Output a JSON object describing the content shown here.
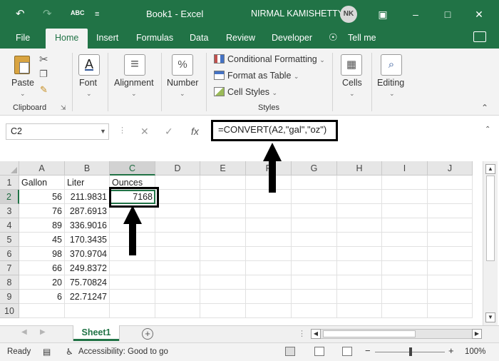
{
  "titlebar": {
    "undo_icon": "undo-icon",
    "redo_icon": "redo-icon",
    "spell_icon_label": "ABC",
    "doc_title": "Book1  -  Excel",
    "user_name": "NIRMAL KAMISHETTY",
    "user_initials": "NK",
    "window_buttons": [
      "ribbon-display-icon",
      "minimize-icon",
      "maximize-icon",
      "close-icon"
    ]
  },
  "tabs": [
    "File",
    "Home",
    "Insert",
    "Formulas",
    "Data",
    "Review",
    "Developer"
  ],
  "active_tab": "Home",
  "tell_me": "Tell me",
  "ribbon": {
    "clipboard": {
      "paste": "Paste",
      "group": "Clipboard"
    },
    "font": {
      "label": "Font",
      "glyph": "A"
    },
    "alignment": {
      "label": "Alignment",
      "glyph": "≡"
    },
    "number": {
      "label": "Number",
      "glyph": "%"
    },
    "styles": {
      "conditional": "Conditional Formatting",
      "format_table": "Format as Table",
      "cell_styles": "Cell Styles",
      "group": "Styles"
    },
    "cells": {
      "label": "Cells"
    },
    "editing": {
      "label": "Editing"
    }
  },
  "formula_bar": {
    "name_box": "C2",
    "fx": "fx",
    "formula": "=CONVERT(A2,\"gal\",\"oz\")"
  },
  "sheet": {
    "columns": [
      "A",
      "B",
      "C",
      "D",
      "E",
      "F",
      "G",
      "H",
      "I",
      "J"
    ],
    "rows": [
      "1",
      "2",
      "3",
      "4",
      "5",
      "6",
      "7",
      "8",
      "9",
      "10"
    ],
    "headers": {
      "A": "Gallon",
      "B": "Liter",
      "C": "Ounces"
    },
    "data": [
      {
        "A": "56",
        "B": "211.9831",
        "C": "7168"
      },
      {
        "A": "76",
        "B": "287.6913",
        "C": ""
      },
      {
        "A": "89",
        "B": "336.9016",
        "C": ""
      },
      {
        "A": "45",
        "B": "170.3435",
        "C": ""
      },
      {
        "A": "98",
        "B": "370.9704",
        "C": ""
      },
      {
        "A": "66",
        "B": "249.8372",
        "C": ""
      },
      {
        "A": "20",
        "B": "75.70824",
        "C": ""
      },
      {
        "A": "6",
        "B": "22.71247",
        "C": ""
      }
    ],
    "active_cell": "C2"
  },
  "sheet_tabs": {
    "tabs": [
      "Sheet1"
    ],
    "active": "Sheet1"
  },
  "statusbar": {
    "ready": "Ready",
    "accessibility": "Accessibility: Good to go",
    "zoom": "100%",
    "zoom_minus": "−",
    "zoom_plus": "+"
  },
  "accent_color": "#217346",
  "annotation_color": "#000000"
}
